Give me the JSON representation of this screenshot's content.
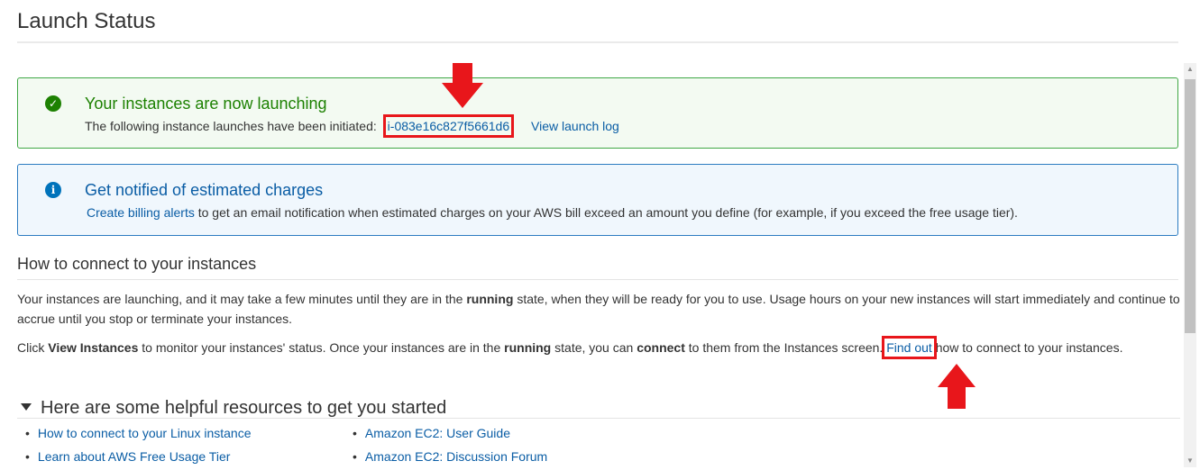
{
  "page": {
    "title": "Launch Status"
  },
  "success_alert": {
    "icon": "check-circle-icon",
    "heading": "Your instances are now launching",
    "body_prefix": "The following instance launches have been initiated:",
    "instance_id": "i-083e16c827f5661d6",
    "view_log": "View launch log"
  },
  "info_alert": {
    "icon": "info-circle-icon",
    "heading": "Get notified of estimated charges",
    "link": "Create billing alerts",
    "body_suffix": "to get an email notification when estimated charges on your AWS bill exceed an amount you define (for example, if you exceed the free usage tier)."
  },
  "connect": {
    "heading": "How to connect to your instances",
    "p1": {
      "a": "Your instances are launching, and it may take a few minutes until they are in the ",
      "b_running": "running",
      "c": " state, when they will be ready for you to use. Usage hours on your new instances will start immediately and continue to accrue until you stop or terminate your instances."
    },
    "p2": {
      "a": "Click ",
      "b_view": "View Instances",
      "c": " to monitor your instances' status. Once your instances are in the ",
      "d_running": "running",
      "e": " state, you can ",
      "f_connect": "connect",
      "g": " to them from the Instances screen. ",
      "find_out": "Find out",
      "h": " how to connect to your instances."
    }
  },
  "resources": {
    "heading": "Here are some helpful resources to get you started",
    "left": [
      "How to connect to your Linux instance",
      "Learn about AWS Free Usage Tier"
    ],
    "right": [
      "Amazon EC2: User Guide",
      "Amazon EC2: Discussion Forum"
    ]
  },
  "colors": {
    "highlight_red": "#e8161b",
    "link_blue": "#0a5da5",
    "success_green": "#1d8102",
    "info_blue": "#0073bb"
  }
}
